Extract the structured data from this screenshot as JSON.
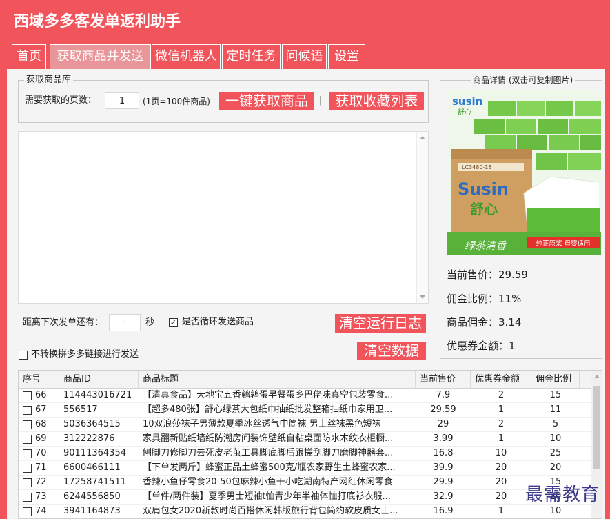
{
  "window": {
    "title": "西域多多客发单返利助手"
  },
  "tabs": [
    {
      "label": "首页",
      "active": false
    },
    {
      "label": "获取商品并发送",
      "active": true
    },
    {
      "label": "微信机器人",
      "active": false
    },
    {
      "label": "定时任务",
      "active": false
    },
    {
      "label": "问候语",
      "active": false
    },
    {
      "label": "设置",
      "active": false
    }
  ],
  "fetch_group": {
    "legend": "获取商品库",
    "pages_label": "需要获取的页数：",
    "pages_value": "1",
    "pages_note": "(1页=100件商品)",
    "fetch_button": "一键获取商品",
    "divider": "|",
    "favorites_button": "获取收藏列表"
  },
  "schedule": {
    "countdown_label": "距离下次发单还有：",
    "countdown_value": "-",
    "seconds_unit": "秒",
    "loop_label": "是否循环发送商品",
    "loop_checked": true,
    "clear_log_button": "清空运行日志"
  },
  "convert": {
    "label": "不转换拼多多链接进行发送",
    "checked": false,
    "clear_data_button": "清空数据"
  },
  "detail": {
    "legend": "商品详情 (双击可复制图片)",
    "image": {
      "logo_brand": "susin",
      "logo_cn": "舒心",
      "box_code": "LC3480-18",
      "box_brand": "Susin",
      "box_cn": "舒心",
      "tagline": "绿茶清香",
      "banner": "纯正原浆 母婴适用"
    },
    "price_label": "当前售价：",
    "price": "29.59",
    "rate_label": "佣金比例：",
    "rate": "11%",
    "commission_label": "商品佣金：",
    "commission": "3.14",
    "coupon_label": "优惠券金额：",
    "coupon": "1"
  },
  "table": {
    "headers": [
      "序号",
      "商品ID",
      "商品标题",
      "当前售价",
      "优惠券金额",
      "佣金比例"
    ],
    "rows": [
      [
        "66",
        "114443016721",
        "【清真食品】天地宝五香鹌鹑蛋早餐蛋乡巴佬味真空包装零食...",
        "7.9",
        "2",
        "15"
      ],
      [
        "67",
        "556517",
        "【超多480张】舒心绿茶大包纸巾抽纸批发整箱抽纸巾家用卫...",
        "29.59",
        "1",
        "11"
      ],
      [
        "68",
        "5036364515",
        "10双浪莎袜子男薄款夏季冰丝透气中筒袜 男士丝袜黑色短袜",
        "29",
        "2",
        "5"
      ],
      [
        "69",
        "312222876",
        "家具翻新贴纸墙纸防潮房间装饰壁纸自粘桌面防水木纹衣柜橱...",
        "3.99",
        "1",
        "10"
      ],
      [
        "70",
        "90111364354",
        "刨脚刀修脚刀去死皮老茧工具脚底脚后跟搓刮脚刀磨脚神器套...",
        "16.8",
        "10",
        "25"
      ],
      [
        "71",
        "6600466111",
        "【下单发两斤】蜂蜜正品土蜂蜜500克/瓶农家野生土蜂蜜农家...",
        "39.9",
        "20",
        "20"
      ],
      [
        "72",
        "17258741511",
        "香辣小鱼仔零食20-50包麻辣小鱼干小吃湖南特产网红休闲零食",
        "29.9",
        "20",
        "15"
      ],
      [
        "73",
        "6244556850",
        "【单件/两件装】夏季男士短袖t恤青少年半袖体恤打底衫衣服...",
        "32.9",
        "20",
        "20"
      ],
      [
        "74",
        "3941164873",
        "双肩包女2020新款时尚百搭休闲韩版旅行背包简约软皮质女士...",
        "16.9",
        "1",
        "10"
      ]
    ]
  },
  "watermark": "最需教育",
  "colors": {
    "accent": "#f2545b",
    "active_tab": "#e9969a",
    "panel_background": "#f4f4f4",
    "watermark": "#3d3a8c"
  }
}
